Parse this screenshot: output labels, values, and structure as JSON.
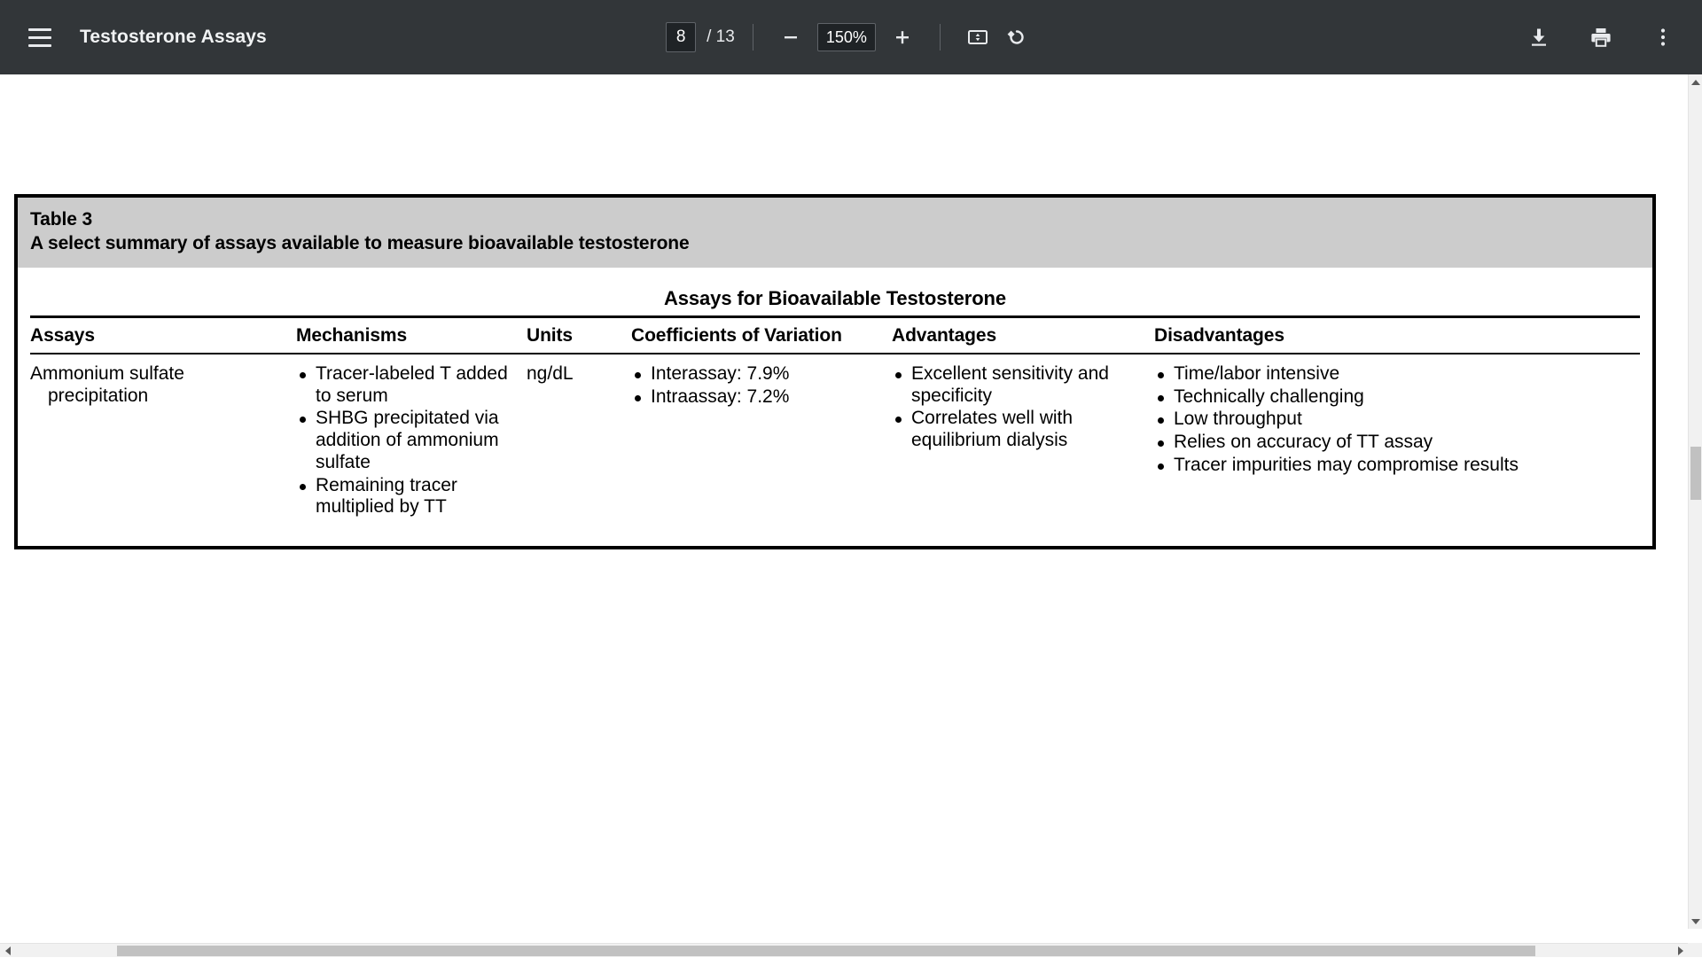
{
  "toolbar": {
    "menu_icon": "hamburger-menu-icon",
    "title": "Testosterone Assays",
    "page_current": "8",
    "page_total_label": "/ 13",
    "zoom_out_icon": "minus-icon",
    "zoom_level": "150%",
    "zoom_in_icon": "plus-icon",
    "fit_page_icon": "fit-to-page-icon",
    "rotate_icon": "rotate-counterclockwise-icon",
    "download_icon": "download-icon",
    "print_icon": "print-icon",
    "more_icon": "more-options-icon"
  },
  "document": {
    "table": {
      "caption_label": "Table 3",
      "caption_title": "A select summary of assays available to measure bioavailable testosterone",
      "span_header": "Assays for Bioavailable Testosterone",
      "columns": [
        "Assays",
        "Mechanisms",
        "Units",
        "Coefficients of Variation",
        "Advantages",
        "Disadvantages"
      ],
      "rows": [
        {
          "assay": "Ammonium sulfate precipitation",
          "mechanisms": [
            "Tracer-labeled T added to serum",
            "SHBG precipitated via addition of ammonium sulfate",
            "Remaining tracer multiplied by TT"
          ],
          "units": "ng/dL",
          "cv": [
            "Interassay: 7.9%",
            "Intraassay: 7.2%"
          ],
          "advantages": [
            "Excellent sensitivity and specificity",
            "Correlates well with equilibrium dialysis"
          ],
          "disadvantages": [
            "Time/labor intensive",
            "Technically challenging",
            "Low throughput",
            "Relies on accuracy of TT assay",
            "Tracer impurities may compromise results"
          ]
        }
      ]
    }
  },
  "scrollbars": {
    "vertical_up_icon": "scroll-up-arrow-icon",
    "vertical_down_icon": "scroll-down-arrow-icon",
    "horizontal_left_icon": "scroll-left-arrow-icon",
    "horizontal_right_icon": "scroll-right-arrow-icon"
  },
  "colors": {
    "toolbar_bg": "#323639",
    "caption_bg": "#cccccc",
    "page_bg": "#ffffff",
    "rule": "#000000"
  }
}
